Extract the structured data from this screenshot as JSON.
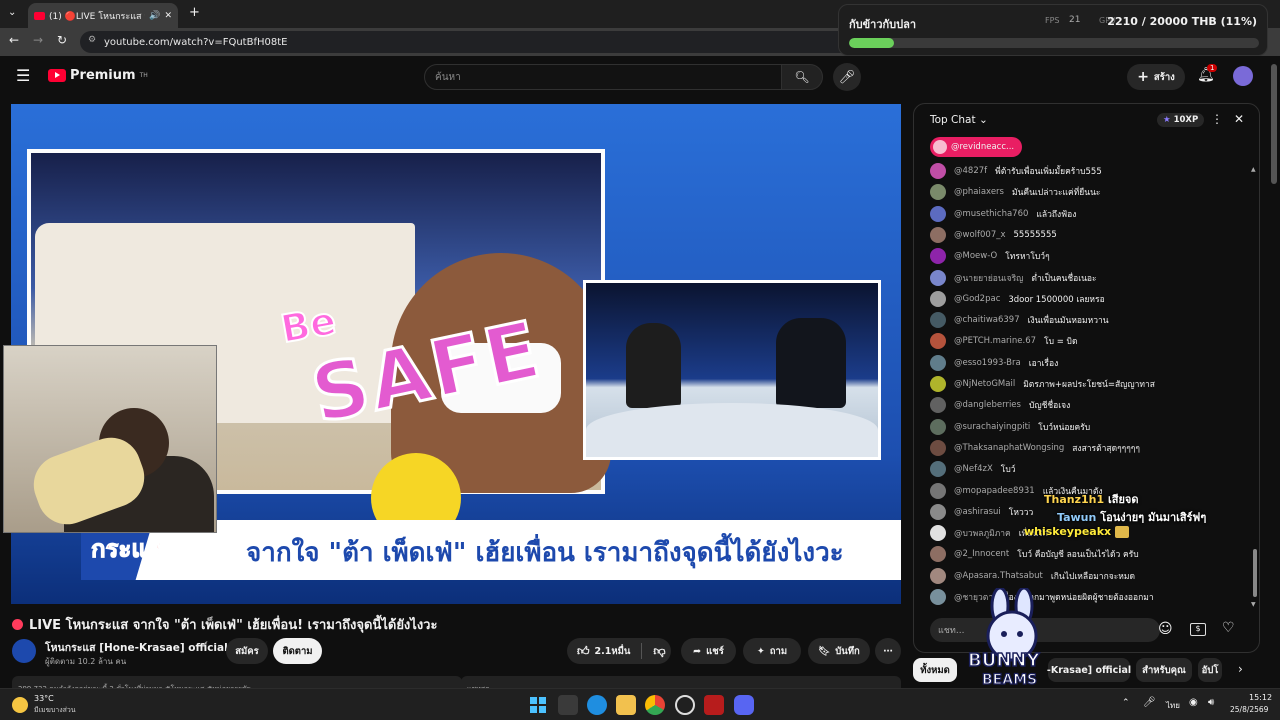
{
  "browser": {
    "tab_title": "(1) 🔴LIVE โหนกระแส จากใจ",
    "url": "youtube.com/watch?v=FQutBfH08tE"
  },
  "header": {
    "brand": "Premium",
    "brand_sup": "TH",
    "search_placeholder": "ค้นหา",
    "create_label": "สร้าง",
    "notification_count": "1"
  },
  "video": {
    "be_text": "Be",
    "safe_text": "SAFE",
    "banner_text": "จากใจ \"ต้า เพ็ดเฟ่\" เฮ้ยเพื่อน เรามาถึงจุดนี้ได้ยังไงวะ",
    "banner_logo": "กระแส",
    "title": "LIVE โหนกระแส จากใจ \"ต้า เพ็ดเฟ่\" เฮ้ยเพื่อน! เรามาถึงจุดนี้ได้ยังไงวะ",
    "channel_name": "โหนกระแส [Hone-Krasae] official",
    "subscribers": "ผู้ติดตาม 10.2 ล้าน คน",
    "join_label": "สมัคร",
    "subscribe_label": "ติดตาม",
    "likes": "2.1หมื่น",
    "share_label": "แชร์",
    "ask_label": "ถาม",
    "save_label": "บันทึก",
    "stats_partial": "299,732 คนกำลังดูอยู่ขณะนี้ 2 ชั่วโมงที่ผ่านมา #โหนกระแส #หน่อยกรรชัย",
    "desc_partial": "แชทสด"
  },
  "chat": {
    "mode": "Top Chat",
    "xp": "10XP",
    "pinned_user": "@revidneacc...",
    "input_placeholder": "แชท...",
    "messages": [
      {
        "user": "@4827f",
        "text": "พี่ต้ารับเพื่อนเพิ่มมั้ยคร้าบ555",
        "color": "#c04ea6"
      },
      {
        "user": "@phaiaxers",
        "text": "มันคืนเปล่าวะแค่ที่ยืนนะ",
        "color": "#7a8a6a"
      },
      {
        "user": "@musethicha760",
        "text": "แล้วถึงฟ้อง",
        "color": "#5c6bc0"
      },
      {
        "user": "@wolf007_x",
        "text": "55555555",
        "color": "#8d6e63"
      },
      {
        "user": "@Moew-O",
        "text": "โทรหาโบว์ๆ",
        "color": "#8e24aa"
      },
      {
        "user": "@นายยาย่อนเจริญ",
        "text": "ต่ำเป็นคนชื่อเนอะ",
        "color": "#7986cb"
      },
      {
        "user": "@God2pac",
        "text": "3door 1500000 เลยหรอ",
        "color": "#9e9e9e"
      },
      {
        "user": "@chaitiwa6397",
        "text": "เงินเพื่อนมันหอมหวาน",
        "color": "#455a64"
      },
      {
        "user": "@PETCH.marine.67",
        "text": "โบ = บิด",
        "color": "#b5533c"
      },
      {
        "user": "@esso1993-Bra",
        "text": "เอาเรื่อง",
        "color": "#607d8b"
      },
      {
        "user": "@NjNetoGMail",
        "text": "มิตรภาพ+ผลประโยชน์=สัญญาทาส",
        "color": "#afb42b"
      },
      {
        "user": "@dangleberries",
        "text": "บัญชีชื่อเจง",
        "color": "#616161"
      },
      {
        "user": "@surachaiyingpiti",
        "text": "โบว์หน่อยครับ",
        "color": "#5d6d5e"
      },
      {
        "user": "@ThaksanaphatWongsing",
        "text": "สงสารต้าสุดๆๆๆๆๆ",
        "color": "#6d4c41"
      },
      {
        "user": "@Nef4zX",
        "text": "โบว์",
        "color": "#546e7a"
      },
      {
        "user": "@mopapadee8931",
        "text": "แล้วเงินคืนมาตัง",
        "color": "#757575"
      },
      {
        "user": "@ashirasui",
        "text": "โหววว",
        "color": "#8a8a8a"
      },
      {
        "user": "@บวพลภูมิภาค",
        "text": "เพื่อนรัก",
        "color": "#e0e0e0"
      },
      {
        "user": "@2_Innocent",
        "text": "โบว์ คือบัญชี ลอนเป็นไรได้ว ครับ",
        "color": "#8d6e63"
      },
      {
        "user": "@Apasara.Thatsabut",
        "text": "เกินไปเหลือมากจะหมด",
        "color": "#a1887f"
      },
      {
        "user": "@ชายุวตา",
        "text": "เรื่องนี้ลอกมาพูดหน่อยผิดผู้ชายต้องออกมา",
        "color": "#78909c"
      }
    ],
    "overlays": [
      {
        "user": "Thanz1h1",
        "text": "เสียจด"
      },
      {
        "user": "Tawun",
        "text": "โอนง่ายๆ มันมาเสิร์ฟๆ"
      },
      {
        "user": "whiskeypeakx",
        "text": ""
      }
    ]
  },
  "goal": {
    "title": "กับข้าวกับปลา",
    "amount": "2210 / 20000 THB (11%)",
    "progress_pct": 11,
    "fps_label": "FPS",
    "fps_value": "21",
    "gpu_label": "GPU"
  },
  "filters": {
    "all": "ทั้งหมด",
    "channel_partial": "-Krasae] official",
    "for_you": "สำหรับคุณ",
    "more_partial": "อัปโ"
  },
  "logo_overlay": {
    "line1": "BUNNY",
    "line2": "BEAMS"
  },
  "taskbar": {
    "weather_temp": "33°C",
    "weather_desc": "มีเมฆบางส่วน",
    "lang": "ไทย",
    "time": "15:12",
    "date": "25/8/2569"
  },
  "colors": {
    "accent_red": "#ff0033",
    "goal_green": "#6bd05b",
    "banner_blue": "#1d49ad",
    "pinned_pink": "#e91e63"
  }
}
